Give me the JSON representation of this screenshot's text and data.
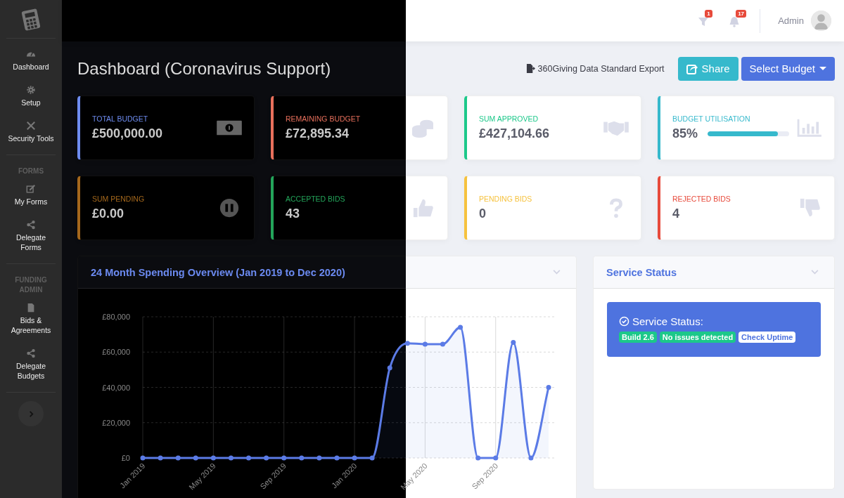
{
  "sidebar": {
    "sections": [
      {
        "items": [
          {
            "label": "Dashboard"
          },
          {
            "label": "Setup"
          },
          {
            "label": "Security Tools"
          }
        ]
      },
      {
        "heading": "FORMS",
        "items": [
          {
            "label": "My Forms"
          },
          {
            "label": "Delegate\nForms"
          }
        ]
      },
      {
        "heading": "FUNDING\nADMIN",
        "items": [
          {
            "label": "Bids &\nAgreements"
          },
          {
            "label": "Delegate\nBudgets"
          }
        ]
      }
    ]
  },
  "topbar": {
    "notifications": [
      {
        "count": "1"
      },
      {
        "count": "17"
      }
    ],
    "user": "Admin"
  },
  "header": {
    "title": "Dashboard (Coronavirus Support)",
    "export_link": "360Giving Data Standard Export",
    "buttons": [
      {
        "label": "Share",
        "kind": "share"
      },
      {
        "label": "Select Budget",
        "kind": "dropdown"
      }
    ]
  },
  "cards": [
    {
      "label": "TOTAL BUDGET",
      "value": "£500,000.00",
      "color": "#6e8cf0",
      "kind": "stat"
    },
    {
      "label": "REMAINING BUDGET",
      "value": "£72,895.34",
      "color": "#e8705c",
      "kind": "stat"
    },
    {
      "label": "SUM APPROVED",
      "value": "£427,104.66",
      "color": "#1cc88a",
      "kind": "stat"
    },
    {
      "label": "BUDGET UTILISATION",
      "value": "85%",
      "color": "#36b9cc",
      "kind": "progress",
      "level": 0.86
    },
    {
      "label": "SUM PENDING",
      "value": "£0.00",
      "color": "#a5681c",
      "kind": "stat"
    },
    {
      "label": "ACCEPTED BIDS",
      "value": "43",
      "color": "#23a55a",
      "kind": "stat"
    },
    {
      "label": "PENDING BIDS",
      "value": "0",
      "color": "#f6c23e",
      "kind": "stat"
    },
    {
      "label": "REJECTED BIDS",
      "value": "4",
      "color": "#e74a3b",
      "kind": "stat"
    }
  ],
  "spending": {
    "chart_data": {
      "type": "area",
      "title": "24 Month Spending Overview (Jan 2019 to Dec 2020)",
      "grid": true,
      "categories": [
        "Jan 2019",
        null,
        null,
        null,
        "May 2019",
        null,
        null,
        null,
        "Sep 2019",
        null,
        null,
        null,
        "Jan 2020",
        null,
        null,
        null,
        "May 2020",
        null,
        null,
        null,
        "Sep 2020",
        null,
        null,
        null
      ],
      "ylim": [
        0,
        80000
      ],
      "yticks": [
        {
          "value": 0,
          "label": "£0"
        },
        {
          "value": 20000,
          "label": "£20,000"
        },
        {
          "value": 40000,
          "label": "£40,000"
        },
        {
          "value": 60000,
          "label": "£60,000"
        },
        {
          "value": 80000,
          "label": "£80,000"
        }
      ],
      "series": [
        {
          "color": "#5b7be6",
          "values": [
            0,
            0,
            0,
            0,
            0,
            0,
            0,
            0,
            0,
            0,
            0,
            0,
            0,
            0,
            51000,
            65000,
            64500,
            64500,
            74000,
            0,
            0,
            65500,
            0,
            40000
          ]
        }
      ]
    }
  },
  "service": {
    "title": "Service Status",
    "heading": "Service Status:",
    "badges": [
      {
        "label": "Build 2.6",
        "kind": "success"
      },
      {
        "label": "No issues detected",
        "kind": "success"
      },
      {
        "label": "Check Uptime",
        "kind": "link"
      }
    ]
  }
}
